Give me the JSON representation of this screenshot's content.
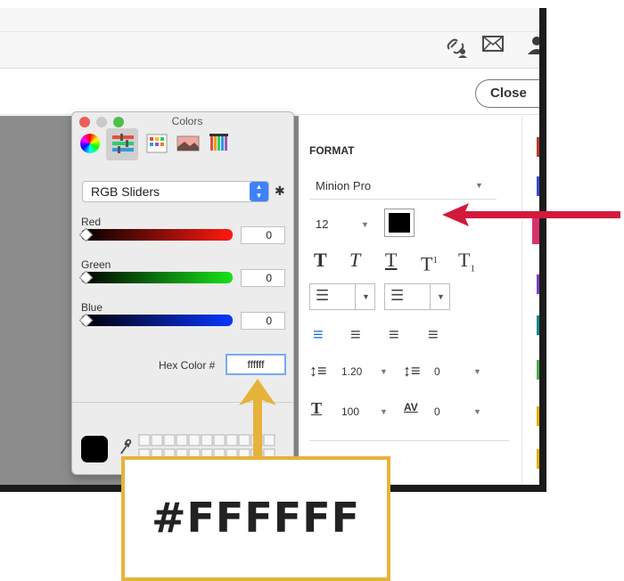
{
  "toolbar": {
    "icons": [
      "link-user-icon",
      "mail-icon",
      "user-icon"
    ],
    "close_label": "Close"
  },
  "format_panel": {
    "title": "FORMAT",
    "font_family": "Minion Pro",
    "font_size": "12",
    "text_color": "#000000",
    "style_buttons": [
      "T",
      "T",
      "T",
      "T",
      "T"
    ],
    "line_spacing": "1.20",
    "paragraph_spacing": "0",
    "horizontal_scale": "100",
    "tracking": "0"
  },
  "colors_window": {
    "title": "Colors",
    "mode": "RGB Sliders",
    "channels": [
      {
        "name": "Red",
        "value": "0"
      },
      {
        "name": "Green",
        "value": "0"
      },
      {
        "name": "Blue",
        "value": "0"
      }
    ],
    "hex_label": "Hex Color #",
    "hex_value": "ffffff",
    "current_color": "#000000"
  },
  "callout": {
    "text": "#FFFFFF"
  },
  "colors": {
    "annotation_red": "#d11a3c",
    "annotation_gold": "#e6b33a",
    "accent_blue": "#1a73e8"
  }
}
